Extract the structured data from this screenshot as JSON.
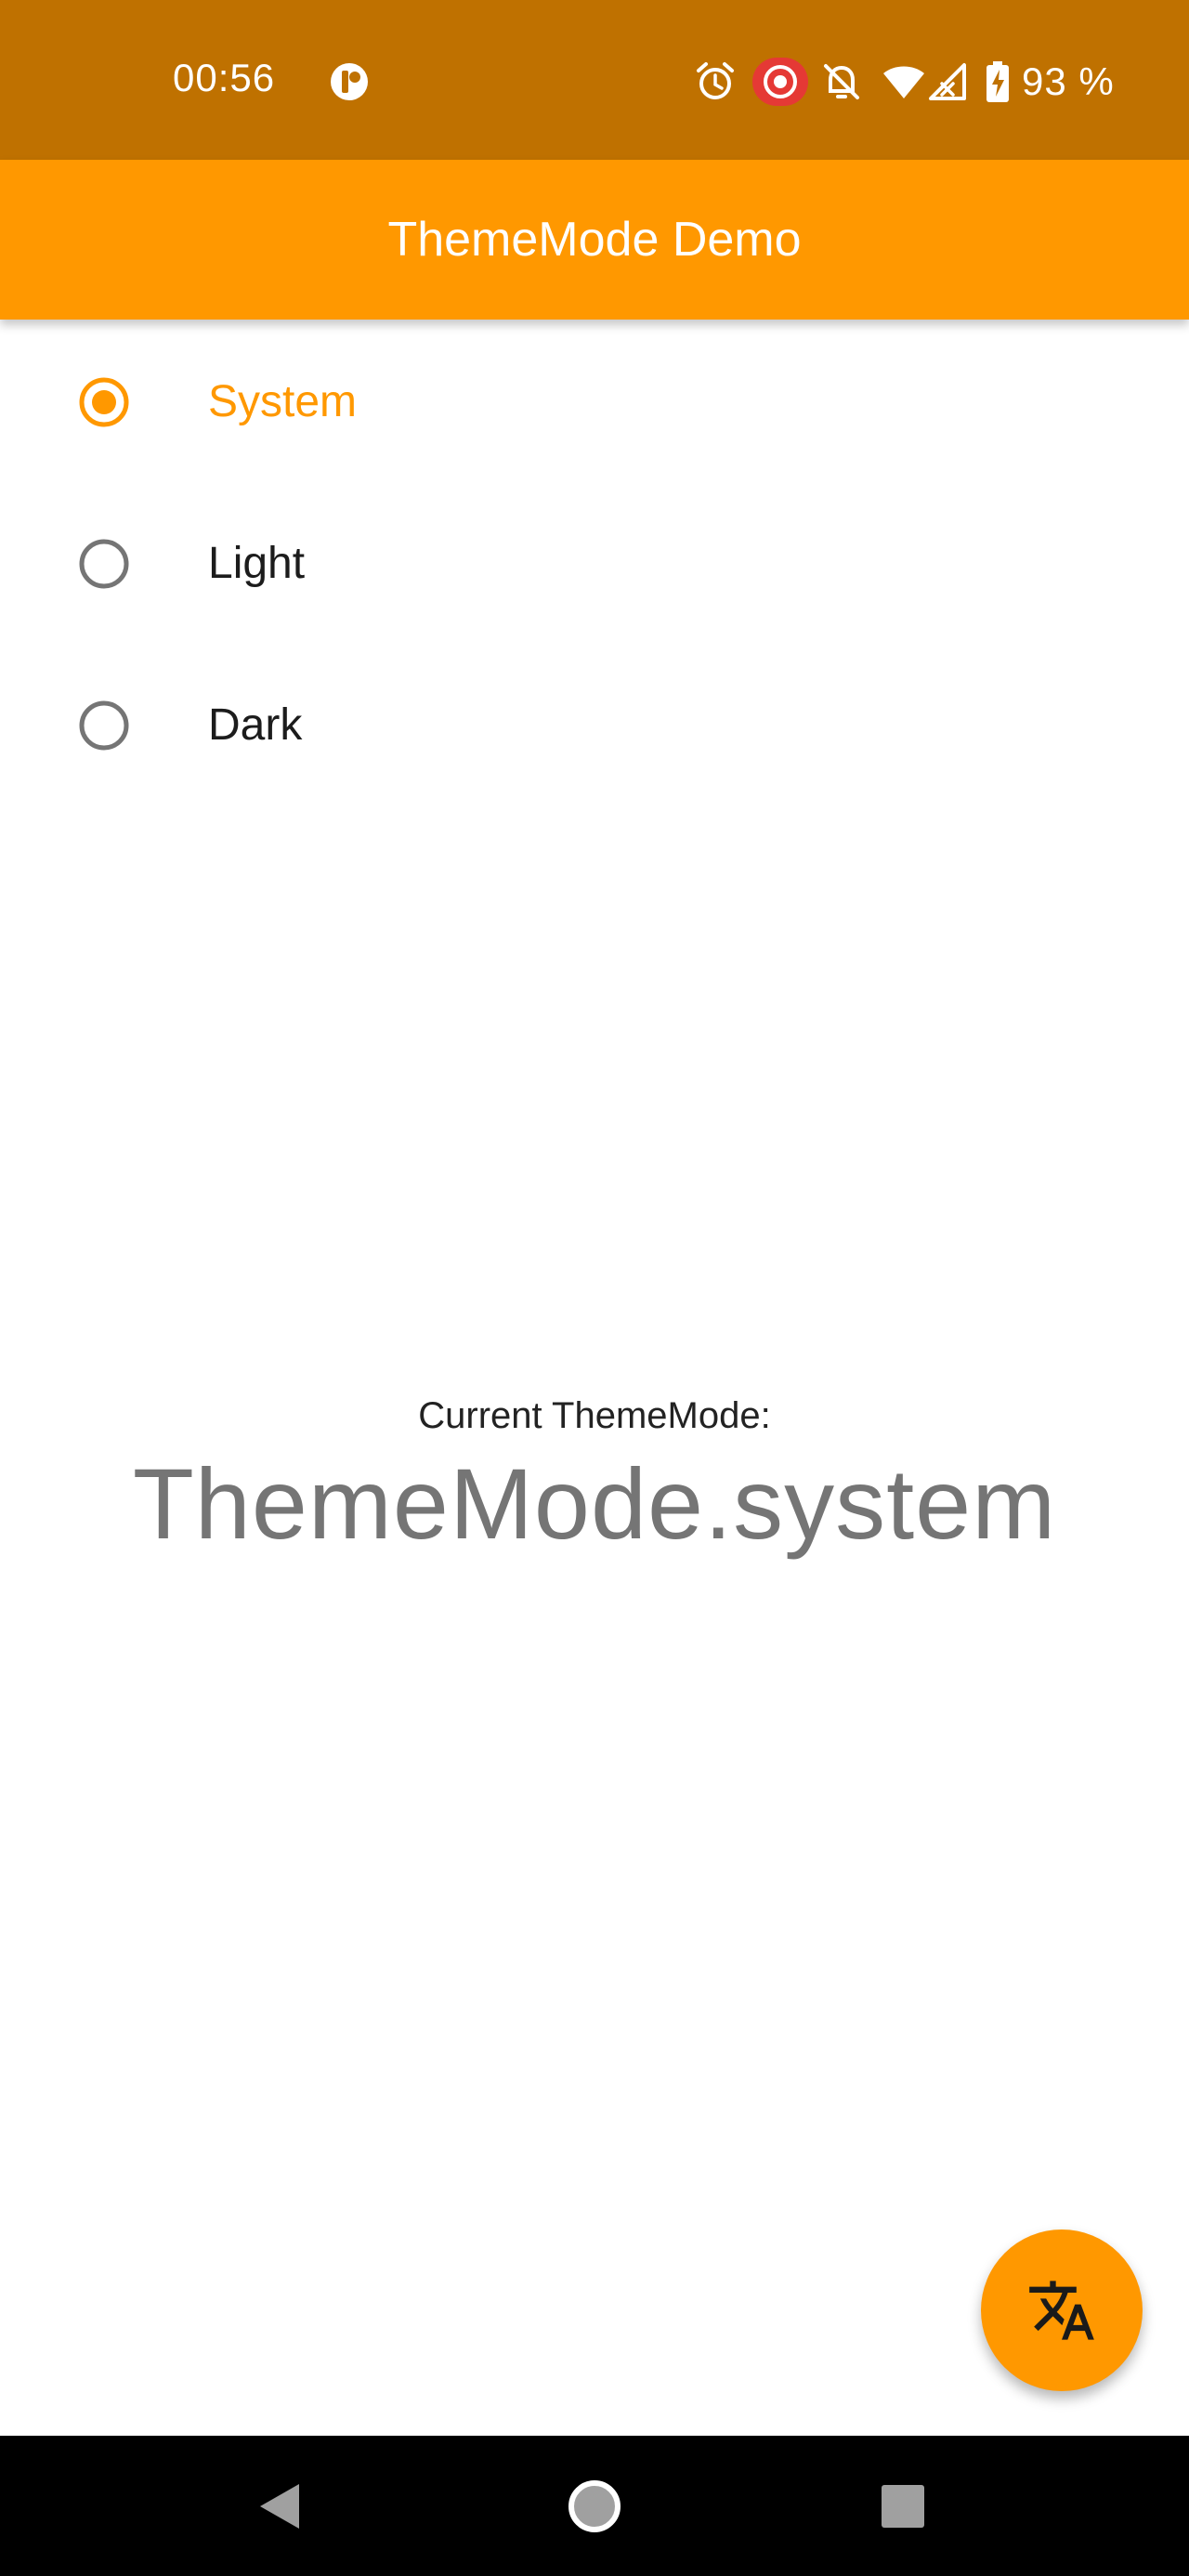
{
  "status_bar": {
    "time": "00:56",
    "battery_percent": "93 %",
    "background_color": "#bf7100",
    "icons": [
      "app-notification-icon",
      "alarm-icon",
      "screen-record-icon",
      "do-not-disturb-icon",
      "wifi-icon",
      "signal-icon",
      "battery-charging-icon"
    ]
  },
  "app_bar": {
    "title": "ThemeMode Demo",
    "background_color": "#ff9800"
  },
  "theme_options": [
    {
      "label": "System",
      "selected": true
    },
    {
      "label": "Light",
      "selected": false
    },
    {
      "label": "Dark",
      "selected": false
    }
  ],
  "current": {
    "caption": "Current ThemeMode:",
    "value": "ThemeMode.system"
  },
  "fab": {
    "icon": "translate-icon"
  },
  "nav_bar": {
    "icons": [
      "back-icon",
      "home-icon",
      "recents-icon"
    ]
  },
  "colors": {
    "accent": "#ff9800",
    "radio_unselected": "#757575"
  }
}
